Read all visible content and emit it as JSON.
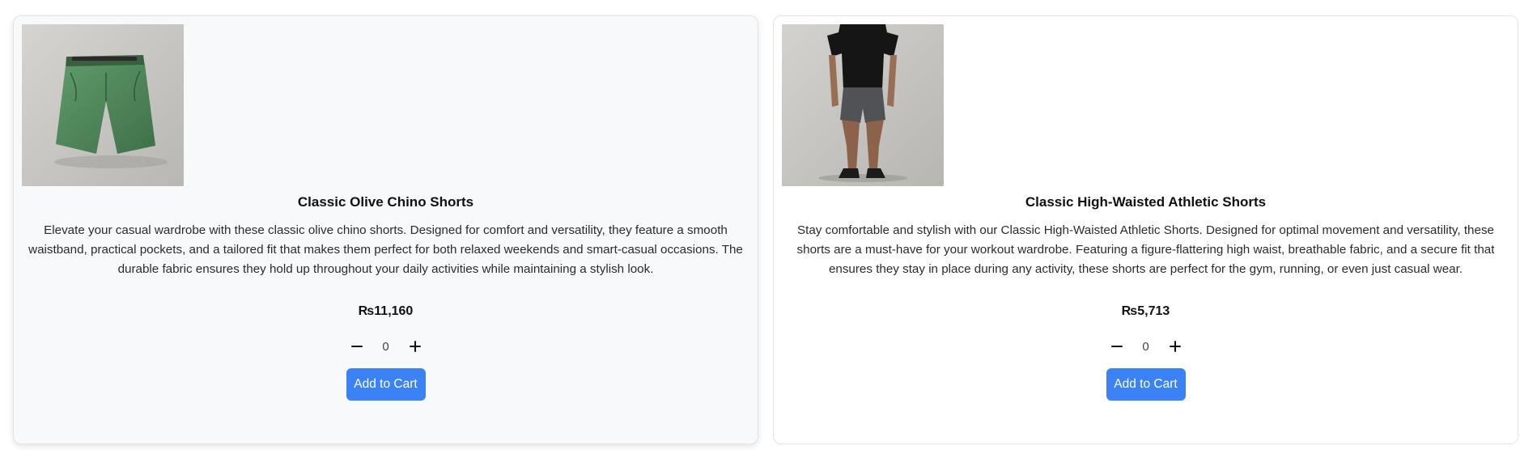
{
  "products": [
    {
      "title": "Classic Olive Chino Shorts",
      "description": "Elevate your casual wardrobe with these classic olive chino shorts. Designed for comfort and versatility, they feature a smooth waistband, practical pockets, and a tailored fit that makes them perfect for both relaxed weekends and smart-casual occasions. The durable fabric ensures they hold up throughout your daily activities while maintaining a stylish look.",
      "price": "₨11,160",
      "quantity": "0",
      "add_label": "Add to Cart",
      "image_icon": "olive-chino-shorts-photo"
    },
    {
      "title": "Classic High-Waisted Athletic Shorts",
      "description": "Stay comfortable and stylish with our Classic High-Waisted Athletic Shorts. Designed for optimal movement and versatility, these shorts are a must-have for your workout wardrobe. Featuring a figure-flattering high waist, breathable fabric, and a secure fit that ensures they stay in place during any activity, these shorts are perfect for the gym, running, or even just casual wear.",
      "price": "₨5,713",
      "quantity": "0",
      "add_label": "Add to Cart",
      "image_icon": "athletic-shorts-model-photo"
    }
  ],
  "colors": {
    "accent": "#3b82f6",
    "card_border": "#dfe3e8",
    "hover_bg": "#f8f9fb"
  }
}
